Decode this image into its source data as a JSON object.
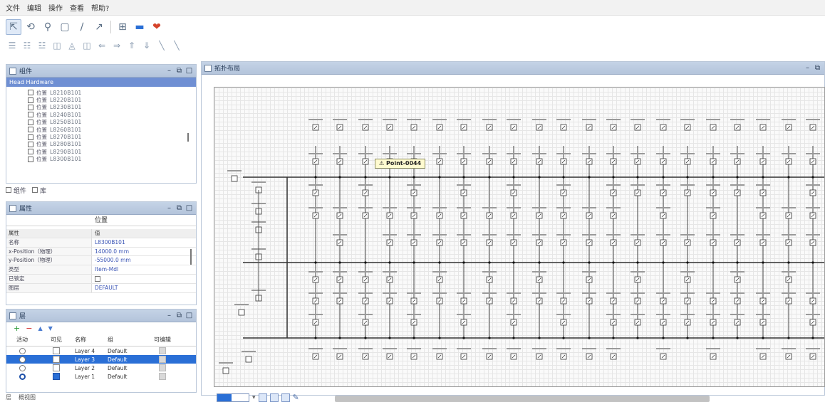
{
  "menubar": {
    "items": [
      "文件",
      "编辑",
      "操作",
      "查看",
      "帮助?"
    ]
  },
  "toolbar1": {
    "icons": [
      "select-arrow-icon",
      "rotate-icon",
      "zoom-icon",
      "rectangle-icon",
      "line-icon",
      "connector-icon",
      "frame-icon",
      "minus-icon",
      "heart-icon"
    ]
  },
  "toolbar2": {
    "icons": [
      "align-left-icon",
      "align-center-icon",
      "align-right-icon",
      "distribute-h-icon",
      "distribute-v-icon",
      "align-middle-icon",
      "arrow-left-icon",
      "arrow-right-icon",
      "arrow-up-icon",
      "arrow-down-icon",
      "skew-icon",
      "skew2-icon"
    ]
  },
  "components": {
    "title": "组件",
    "root": "Head Hardware",
    "items": [
      {
        "label": "位置",
        "code": "L8210B101"
      },
      {
        "label": "位置",
        "code": "L8220B101"
      },
      {
        "label": "位置",
        "code": "L8230B101"
      },
      {
        "label": "位置",
        "code": "L8240B101"
      },
      {
        "label": "位置",
        "code": "L8250B101"
      },
      {
        "label": "位置",
        "code": "L8260B101"
      },
      {
        "label": "位置",
        "code": "L8270B101"
      },
      {
        "label": "位置",
        "code": "L8280B101"
      },
      {
        "label": "位置",
        "code": "L8290B101"
      },
      {
        "label": "位置",
        "code": "L8300B101"
      }
    ]
  },
  "tabs": {
    "tab1": "组件",
    "tab2": "库"
  },
  "properties": {
    "title": "属性",
    "subject": "位置",
    "header": {
      "k": "属性",
      "v": "值"
    },
    "rows": [
      {
        "k": "名称",
        "v": "L8300B101"
      },
      {
        "k": "x-Position（物理）",
        "v": "14000.0 mm"
      },
      {
        "k": "y-Position（物理）",
        "v": "-55000.0 mm"
      },
      {
        "k": "类型",
        "v": "Item-Mdl"
      },
      {
        "k": "已锁定",
        "v": ""
      },
      {
        "k": "图层",
        "v": "DEFAULT"
      }
    ]
  },
  "layers": {
    "title": "层",
    "header": {
      "c1": "活动",
      "c2": "可见",
      "c3": "名称",
      "c4": "组",
      "c5": "可编辑"
    },
    "rows": [
      {
        "name": "Layer 4",
        "group": "Default",
        "active": false,
        "visible": false,
        "editable": false,
        "selected": false
      },
      {
        "name": "Layer 3",
        "group": "Default",
        "active": false,
        "visible": false,
        "editable": false,
        "selected": true
      },
      {
        "name": "Layer 2",
        "group": "Default",
        "active": false,
        "visible": false,
        "editable": false,
        "selected": false
      },
      {
        "name": "Layer 1",
        "group": "Default",
        "active": true,
        "visible": true,
        "editable": false,
        "selected": false
      }
    ]
  },
  "bottom_tabs": {
    "tab1": "层",
    "tab2": "概视图"
  },
  "diagram": {
    "title": "拓扑布局",
    "tooltip": "Point-0044"
  },
  "colors": {
    "panel_title": "#b4c4db",
    "selection": "#2a6fd6",
    "tree_selection": "#6f8fd3",
    "tooltip_bg": "#fffbd0"
  }
}
